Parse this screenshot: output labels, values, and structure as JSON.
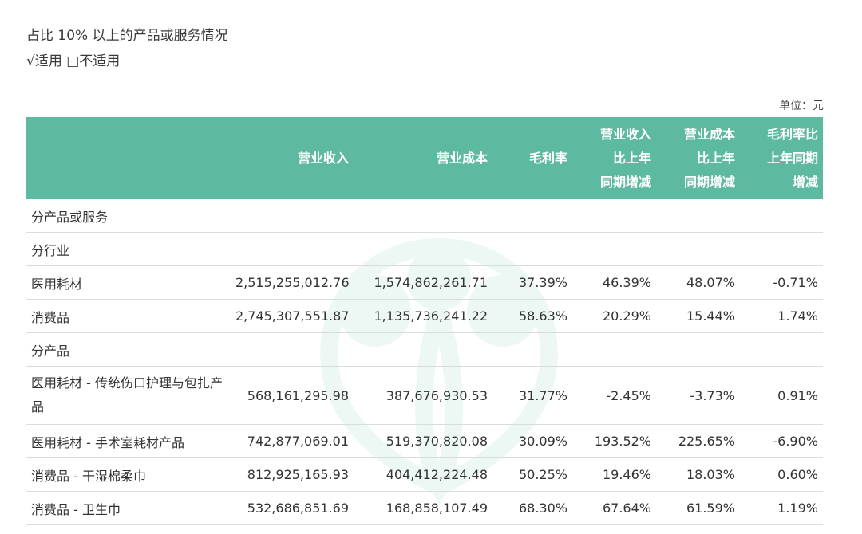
{
  "intro": {
    "title": "占比 10% 以上的产品或服务情况",
    "options": "√适用 □不适用"
  },
  "unit": "单位：元",
  "table": {
    "headers": [
      [
        ""
      ],
      [
        "营业收入"
      ],
      [
        "营业成本"
      ],
      [
        "毛利率"
      ],
      [
        "营业收入",
        "比上年",
        "同期增减"
      ],
      [
        "营业成本",
        "比上年",
        "同期增减"
      ],
      [
        "毛利率比",
        "上年同期",
        "增减"
      ]
    ],
    "rows": [
      {
        "name": "分产品或服务",
        "cells": [
          "",
          "",
          "",
          "",
          "",
          ""
        ]
      },
      {
        "name": "分行业",
        "cells": [
          "",
          "",
          "",
          "",
          "",
          ""
        ]
      },
      {
        "name": "医用耗材",
        "cells": [
          "2,515,255,012.76",
          "1,574,862,261.71",
          "37.39%",
          "46.39%",
          "48.07%",
          "-0.71%"
        ]
      },
      {
        "name": "消费品",
        "cells": [
          "2,745,307,551.87",
          "1,135,736,241.22",
          "58.63%",
          "20.29%",
          "15.44%",
          "1.74%"
        ]
      },
      {
        "name": "分产品",
        "cells": [
          "",
          "",
          "",
          "",
          "",
          ""
        ]
      },
      {
        "name": "医用耗材 - 传统伤口护理与包扎产品",
        "cells": [
          "568,161,295.98",
          "387,676,930.53",
          "31.77%",
          "-2.45%",
          "-3.73%",
          "0.91%"
        ]
      },
      {
        "name": "医用耗材 - 手术室耗材产品",
        "cells": [
          "742,877,069.01",
          "519,370,820.08",
          "30.09%",
          "193.52%",
          "225.65%",
          "-6.90%"
        ]
      },
      {
        "name": "消费品 - 干湿棉柔巾",
        "cells": [
          "812,925,165.93",
          "404,412,224.48",
          "50.25%",
          "19.46%",
          "18.03%",
          "0.60%"
        ]
      },
      {
        "name": "消费品 - 卫生巾",
        "cells": [
          "532,686,851.69",
          "168,858,107.49",
          "68.30%",
          "67.64%",
          "61.59%",
          "1.19%"
        ]
      }
    ]
  }
}
